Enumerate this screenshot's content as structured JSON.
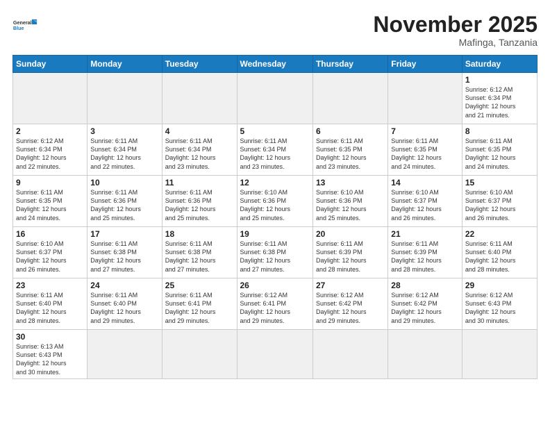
{
  "logo": {
    "line1": "General",
    "line2": "Blue"
  },
  "title": "November 2025",
  "location": "Mafinga, Tanzania",
  "days_of_week": [
    "Sunday",
    "Monday",
    "Tuesday",
    "Wednesday",
    "Thursday",
    "Friday",
    "Saturday"
  ],
  "weeks": [
    [
      {
        "day": "",
        "info": ""
      },
      {
        "day": "",
        "info": ""
      },
      {
        "day": "",
        "info": ""
      },
      {
        "day": "",
        "info": ""
      },
      {
        "day": "",
        "info": ""
      },
      {
        "day": "",
        "info": ""
      },
      {
        "day": "1",
        "info": "Sunrise: 6:12 AM\nSunset: 6:34 PM\nDaylight: 12 hours\nand 21 minutes."
      }
    ],
    [
      {
        "day": "2",
        "info": "Sunrise: 6:12 AM\nSunset: 6:34 PM\nDaylight: 12 hours\nand 22 minutes."
      },
      {
        "day": "3",
        "info": "Sunrise: 6:11 AM\nSunset: 6:34 PM\nDaylight: 12 hours\nand 22 minutes."
      },
      {
        "day": "4",
        "info": "Sunrise: 6:11 AM\nSunset: 6:34 PM\nDaylight: 12 hours\nand 23 minutes."
      },
      {
        "day": "5",
        "info": "Sunrise: 6:11 AM\nSunset: 6:34 PM\nDaylight: 12 hours\nand 23 minutes."
      },
      {
        "day": "6",
        "info": "Sunrise: 6:11 AM\nSunset: 6:35 PM\nDaylight: 12 hours\nand 23 minutes."
      },
      {
        "day": "7",
        "info": "Sunrise: 6:11 AM\nSunset: 6:35 PM\nDaylight: 12 hours\nand 24 minutes."
      },
      {
        "day": "8",
        "info": "Sunrise: 6:11 AM\nSunset: 6:35 PM\nDaylight: 12 hours\nand 24 minutes."
      }
    ],
    [
      {
        "day": "9",
        "info": "Sunrise: 6:11 AM\nSunset: 6:35 PM\nDaylight: 12 hours\nand 24 minutes."
      },
      {
        "day": "10",
        "info": "Sunrise: 6:11 AM\nSunset: 6:36 PM\nDaylight: 12 hours\nand 25 minutes."
      },
      {
        "day": "11",
        "info": "Sunrise: 6:11 AM\nSunset: 6:36 PM\nDaylight: 12 hours\nand 25 minutes."
      },
      {
        "day": "12",
        "info": "Sunrise: 6:10 AM\nSunset: 6:36 PM\nDaylight: 12 hours\nand 25 minutes."
      },
      {
        "day": "13",
        "info": "Sunrise: 6:10 AM\nSunset: 6:36 PM\nDaylight: 12 hours\nand 25 minutes."
      },
      {
        "day": "14",
        "info": "Sunrise: 6:10 AM\nSunset: 6:37 PM\nDaylight: 12 hours\nand 26 minutes."
      },
      {
        "day": "15",
        "info": "Sunrise: 6:10 AM\nSunset: 6:37 PM\nDaylight: 12 hours\nand 26 minutes."
      }
    ],
    [
      {
        "day": "16",
        "info": "Sunrise: 6:10 AM\nSunset: 6:37 PM\nDaylight: 12 hours\nand 26 minutes."
      },
      {
        "day": "17",
        "info": "Sunrise: 6:11 AM\nSunset: 6:38 PM\nDaylight: 12 hours\nand 27 minutes."
      },
      {
        "day": "18",
        "info": "Sunrise: 6:11 AM\nSunset: 6:38 PM\nDaylight: 12 hours\nand 27 minutes."
      },
      {
        "day": "19",
        "info": "Sunrise: 6:11 AM\nSunset: 6:38 PM\nDaylight: 12 hours\nand 27 minutes."
      },
      {
        "day": "20",
        "info": "Sunrise: 6:11 AM\nSunset: 6:39 PM\nDaylight: 12 hours\nand 28 minutes."
      },
      {
        "day": "21",
        "info": "Sunrise: 6:11 AM\nSunset: 6:39 PM\nDaylight: 12 hours\nand 28 minutes."
      },
      {
        "day": "22",
        "info": "Sunrise: 6:11 AM\nSunset: 6:40 PM\nDaylight: 12 hours\nand 28 minutes."
      }
    ],
    [
      {
        "day": "23",
        "info": "Sunrise: 6:11 AM\nSunset: 6:40 PM\nDaylight: 12 hours\nand 28 minutes."
      },
      {
        "day": "24",
        "info": "Sunrise: 6:11 AM\nSunset: 6:40 PM\nDaylight: 12 hours\nand 29 minutes."
      },
      {
        "day": "25",
        "info": "Sunrise: 6:11 AM\nSunset: 6:41 PM\nDaylight: 12 hours\nand 29 minutes."
      },
      {
        "day": "26",
        "info": "Sunrise: 6:12 AM\nSunset: 6:41 PM\nDaylight: 12 hours\nand 29 minutes."
      },
      {
        "day": "27",
        "info": "Sunrise: 6:12 AM\nSunset: 6:42 PM\nDaylight: 12 hours\nand 29 minutes."
      },
      {
        "day": "28",
        "info": "Sunrise: 6:12 AM\nSunset: 6:42 PM\nDaylight: 12 hours\nand 29 minutes."
      },
      {
        "day": "29",
        "info": "Sunrise: 6:12 AM\nSunset: 6:43 PM\nDaylight: 12 hours\nand 30 minutes."
      }
    ],
    [
      {
        "day": "30",
        "info": "Sunrise: 6:13 AM\nSunset: 6:43 PM\nDaylight: 12 hours\nand 30 minutes."
      },
      {
        "day": "",
        "info": ""
      },
      {
        "day": "",
        "info": ""
      },
      {
        "day": "",
        "info": ""
      },
      {
        "day": "",
        "info": ""
      },
      {
        "day": "",
        "info": ""
      },
      {
        "day": "",
        "info": ""
      }
    ]
  ]
}
